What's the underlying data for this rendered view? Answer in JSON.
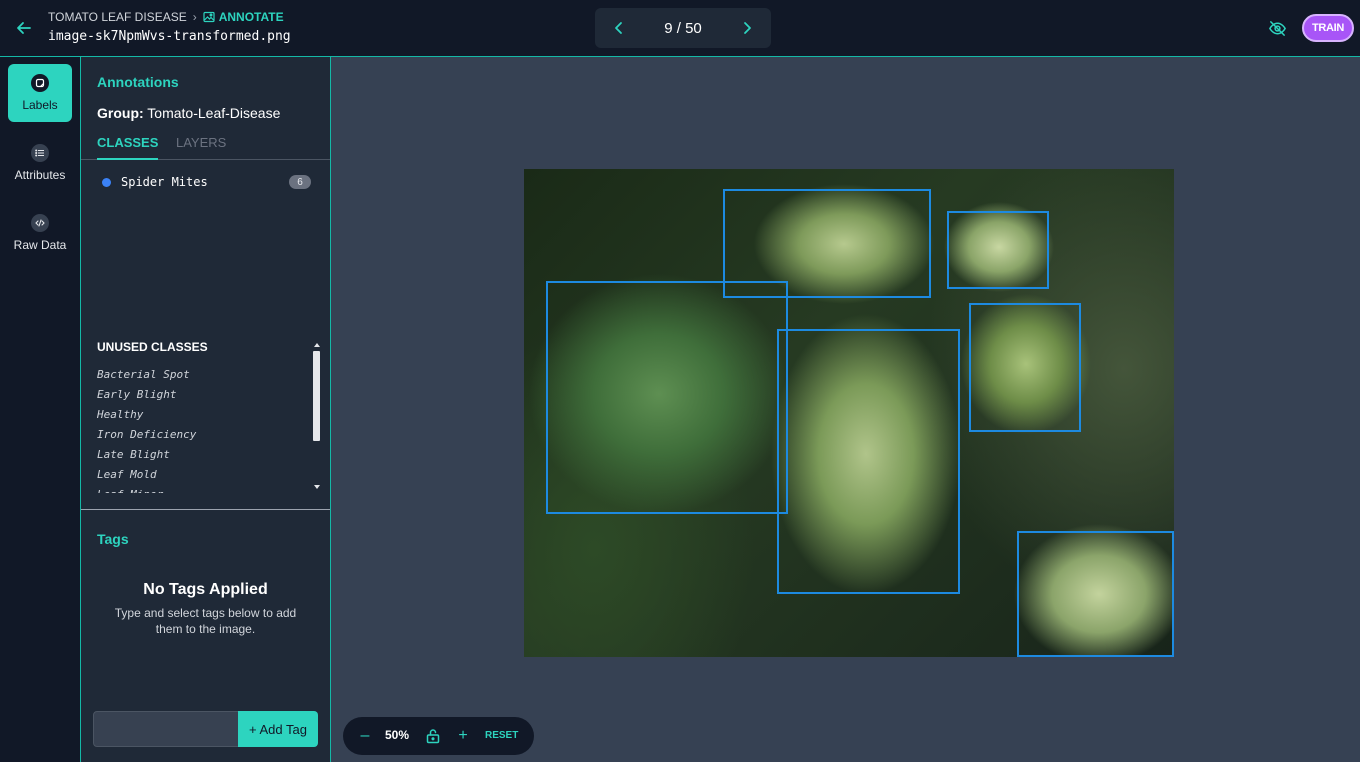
{
  "header": {
    "breadcrumb_project": "TOMATO LEAF DISEASE",
    "breadcrumb_current": "ANNOTATE",
    "filename": "image-sk7NpmWvs-transformed.png",
    "pager_text": "9 / 50",
    "train_label": "TRAIN"
  },
  "rail": {
    "labels": "Labels",
    "attributes": "Attributes",
    "raw_data": "Raw Data"
  },
  "panel": {
    "title": "Annotations",
    "group_label": "Group:",
    "group_name": "Tomato-Leaf-Disease",
    "tab_classes": "CLASSES",
    "tab_layers": "LAYERS",
    "classes": [
      {
        "name": "Spider Mites",
        "count": "6",
        "color": "#3b82f6"
      }
    ],
    "unused_title": "UNUSED CLASSES",
    "unused_classes": [
      "Bacterial Spot",
      "Early Blight",
      "Healthy",
      "Iron Deficiency",
      "Late Blight",
      "Leaf Mold",
      "Leaf Miner"
    ]
  },
  "tags": {
    "title": "Tags",
    "empty_title": "No Tags Applied",
    "empty_text": "Type and select tags below to add them to the image.",
    "input_value": "",
    "add_label": "+ Add Tag"
  },
  "zoom": {
    "minus": "–",
    "level": "50%",
    "plus": "+",
    "reset": "RESET"
  },
  "colors": {
    "accent": "#2dd4bf",
    "bbox": "#1d8ae0",
    "train": "#a855f7"
  }
}
